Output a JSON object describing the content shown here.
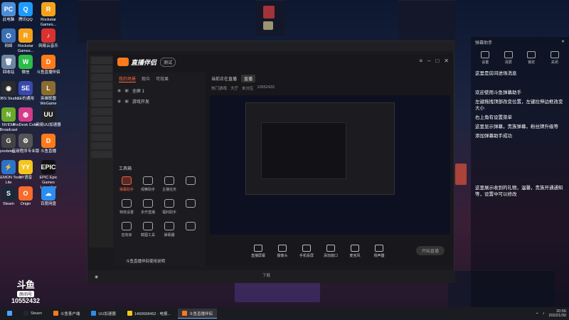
{
  "desktop_icons": [
    {
      "label": "此电脑",
      "color": "#4d8fd6",
      "glyph": "PC",
      "icon": "computer-icon"
    },
    {
      "label": "腾讯QQ",
      "color": "#1e9bff",
      "glyph": "Q",
      "icon": "qq-icon"
    },
    {
      "label": "Rockstar Games...",
      "color": "#f5a21b",
      "glyph": "R",
      "icon": "rockstar-icon"
    },
    {
      "label": "网络",
      "color": "#3b6fb3",
      "glyph": "⛭",
      "icon": "network-icon"
    },
    {
      "label": "Rockstar Games...",
      "color": "#f5a21b",
      "glyph": "R",
      "icon": "rockstar-icon"
    },
    {
      "label": "网易云音乐",
      "color": "#d9322e",
      "glyph": "♪",
      "icon": "music-icon"
    },
    {
      "label": "回收站",
      "color": "#6d87a3",
      "glyph": "🗑",
      "icon": "recycle-bin-icon"
    },
    {
      "label": "微信",
      "color": "#2dbb4a",
      "glyph": "W",
      "icon": "wechat-icon"
    },
    {
      "label": "斗鱼直播伴侣",
      "color": "#ff7a1a",
      "glyph": "D",
      "icon": "douyu-icon"
    },
    {
      "label": "OBS Studio",
      "color": "#2b2b2b",
      "glyph": "◉",
      "icon": "obs-icon"
    },
    {
      "label": "SE的通用",
      "color": "#3949ab",
      "glyph": "SE",
      "icon": "se-icon"
    },
    {
      "label": "英雄联盟WeGame",
      "color": "#8b6b2e",
      "glyph": "L",
      "icon": "lol-icon"
    },
    {
      "label": "NVIDIA Broadcast",
      "color": "#6aaa2a",
      "glyph": "N",
      "icon": "nvidia-icon"
    },
    {
      "label": "ProDesk Color",
      "color": "#d43c8a",
      "glyph": "◍",
      "icon": "color-icon"
    },
    {
      "label": "网易UU加速器",
      "color": "#222",
      "glyph": "UU",
      "icon": "uu-icon"
    },
    {
      "label": "goodstep...",
      "color": "#444",
      "glyph": "G",
      "icon": "app-icon"
    },
    {
      "label": "应用程序专业版",
      "color": "#555",
      "glyph": "⚙",
      "icon": "app-icon"
    },
    {
      "label": "斗鱼直播",
      "color": "#ff7a1a",
      "glyph": "D",
      "icon": "douyu-icon"
    },
    {
      "label": "DAEMON Tools Lite",
      "color": "#2c73c9",
      "glyph": "⚡",
      "icon": "daemon-icon"
    },
    {
      "label": "YY语音",
      "color": "#f4c61d",
      "glyph": "YY",
      "icon": "yy-icon"
    },
    {
      "label": "EPIC Epic Games Launcher",
      "color": "#111",
      "glyph": "EPIC",
      "icon": "epic-icon"
    },
    {
      "label": "Steam",
      "color": "#1b2838",
      "glyph": "S",
      "icon": "steam-icon"
    },
    {
      "label": "Origin",
      "color": "#f56c2d",
      "glyph": "O",
      "icon": "origin-icon"
    },
    {
      "label": "百度网盘",
      "color": "#2b8df0",
      "glyph": "☁",
      "icon": "cloud-icon"
    }
  ],
  "steam_badge": {
    "big": "斗鱼",
    "label": "房间号",
    "number": "10552432"
  },
  "app": {
    "title": "直播伴侣",
    "version": "测试",
    "tabs": [
      "我的场景",
      "观众",
      "可效果"
    ],
    "scenes": [
      "全屏 1",
      "游戏开发"
    ],
    "tools_label": "工具箱",
    "tools": [
      {
        "label": "弹幕助手",
        "hot": true
      },
      {
        "label": "观察助手",
        "hot": false
      },
      {
        "label": "主播任务",
        "hot": false
      },
      {
        "label": "",
        "hot": false
      },
      {
        "label": "特效设置",
        "hot": false
      },
      {
        "label": "多开直播",
        "hot": false
      },
      {
        "label": "福利助手",
        "hot": false
      },
      {
        "label": "",
        "hot": false
      },
      {
        "label": "音效库",
        "hot": false
      },
      {
        "label": "截图工具",
        "hot": false
      },
      {
        "label": "弹幕器",
        "hot": false
      },
      {
        "label": "",
        "hot": false
      }
    ],
    "notice": "斗鱼直播伴侣使用说明",
    "topline": {
      "status": "当前正在直播",
      "badge": "直播",
      "room": "10552432"
    },
    "subline": [
      "热门游戏",
      "大厅",
      "未分区"
    ],
    "bottom_buttons": [
      "直播屏幕",
      "摄像头",
      "手机投屏",
      "添加窗口",
      "麦克风",
      "扬声器"
    ],
    "start_button": "开始直播",
    "footer_center": "下载"
  },
  "chat": {
    "title": "弹幕助手",
    "icons": [
      "设置",
      "清屏",
      "锁定",
      "关闭"
    ],
    "messages": [
      "这里是房间进场消息",
      "欢迎使用斗鱼弹幕助手",
      "左键拖拽顶部改变位置，左键拉伸边框改变大小",
      "右上角有设置菜单",
      "这里显示弹幕，贵族弹幕，粉丝牌升级等",
      "添加弹幕助手成功",
      "这里展示收到的礼物，温馨，贵族开通通知等，设置中可以修改"
    ]
  },
  "taskbar": {
    "items": [
      {
        "label": "Steam",
        "color": "#1b2838",
        "active": false
      },
      {
        "label": "斗鱼客户端",
        "color": "#ff7a1a",
        "active": false
      },
      {
        "label": "UU加速器",
        "color": "#2b8df0",
        "active": false
      },
      {
        "label": "1460668462 · 电报...",
        "color": "#f4c61d",
        "active": false
      },
      {
        "label": "斗鱼直播伴侣",
        "color": "#ff7a1a",
        "active": true
      }
    ],
    "time": "20:56",
    "date": "2022/1/30"
  }
}
